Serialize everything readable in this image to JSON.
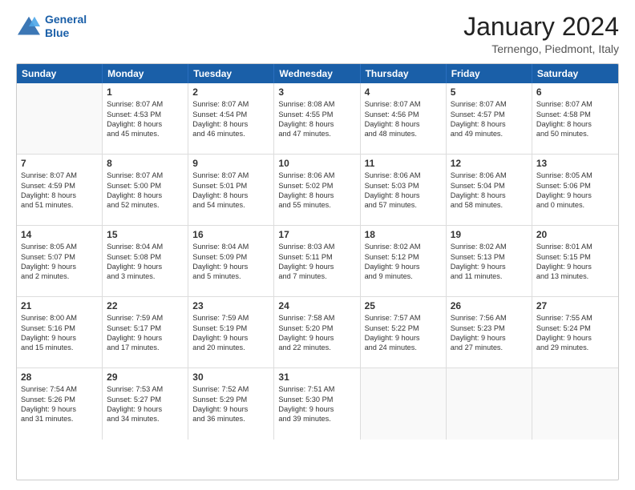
{
  "logo": {
    "line1": "General",
    "line2": "Blue"
  },
  "title": "January 2024",
  "location": "Ternengo, Piedmont, Italy",
  "header_days": [
    "Sunday",
    "Monday",
    "Tuesday",
    "Wednesday",
    "Thursday",
    "Friday",
    "Saturday"
  ],
  "weeks": [
    [
      {
        "day": "",
        "sunrise": "",
        "sunset": "",
        "daylight": "",
        "empty": true
      },
      {
        "day": "1",
        "sunrise": "Sunrise: 8:07 AM",
        "sunset": "Sunset: 4:53 PM",
        "daylight": "Daylight: 8 hours",
        "daylight2": "and 45 minutes."
      },
      {
        "day": "2",
        "sunrise": "Sunrise: 8:07 AM",
        "sunset": "Sunset: 4:54 PM",
        "daylight": "Daylight: 8 hours",
        "daylight2": "and 46 minutes."
      },
      {
        "day": "3",
        "sunrise": "Sunrise: 8:08 AM",
        "sunset": "Sunset: 4:55 PM",
        "daylight": "Daylight: 8 hours",
        "daylight2": "and 47 minutes."
      },
      {
        "day": "4",
        "sunrise": "Sunrise: 8:07 AM",
        "sunset": "Sunset: 4:56 PM",
        "daylight": "Daylight: 8 hours",
        "daylight2": "and 48 minutes."
      },
      {
        "day": "5",
        "sunrise": "Sunrise: 8:07 AM",
        "sunset": "Sunset: 4:57 PM",
        "daylight": "Daylight: 8 hours",
        "daylight2": "and 49 minutes."
      },
      {
        "day": "6",
        "sunrise": "Sunrise: 8:07 AM",
        "sunset": "Sunset: 4:58 PM",
        "daylight": "Daylight: 8 hours",
        "daylight2": "and 50 minutes."
      }
    ],
    [
      {
        "day": "7",
        "sunrise": "Sunrise: 8:07 AM",
        "sunset": "Sunset: 4:59 PM",
        "daylight": "Daylight: 8 hours",
        "daylight2": "and 51 minutes."
      },
      {
        "day": "8",
        "sunrise": "Sunrise: 8:07 AM",
        "sunset": "Sunset: 5:00 PM",
        "daylight": "Daylight: 8 hours",
        "daylight2": "and 52 minutes."
      },
      {
        "day": "9",
        "sunrise": "Sunrise: 8:07 AM",
        "sunset": "Sunset: 5:01 PM",
        "daylight": "Daylight: 8 hours",
        "daylight2": "and 54 minutes."
      },
      {
        "day": "10",
        "sunrise": "Sunrise: 8:06 AM",
        "sunset": "Sunset: 5:02 PM",
        "daylight": "Daylight: 8 hours",
        "daylight2": "and 55 minutes."
      },
      {
        "day": "11",
        "sunrise": "Sunrise: 8:06 AM",
        "sunset": "Sunset: 5:03 PM",
        "daylight": "Daylight: 8 hours",
        "daylight2": "and 57 minutes."
      },
      {
        "day": "12",
        "sunrise": "Sunrise: 8:06 AM",
        "sunset": "Sunset: 5:04 PM",
        "daylight": "Daylight: 8 hours",
        "daylight2": "and 58 minutes."
      },
      {
        "day": "13",
        "sunrise": "Sunrise: 8:05 AM",
        "sunset": "Sunset: 5:06 PM",
        "daylight": "Daylight: 9 hours",
        "daylight2": "and 0 minutes."
      }
    ],
    [
      {
        "day": "14",
        "sunrise": "Sunrise: 8:05 AM",
        "sunset": "Sunset: 5:07 PM",
        "daylight": "Daylight: 9 hours",
        "daylight2": "and 2 minutes."
      },
      {
        "day": "15",
        "sunrise": "Sunrise: 8:04 AM",
        "sunset": "Sunset: 5:08 PM",
        "daylight": "Daylight: 9 hours",
        "daylight2": "and 3 minutes."
      },
      {
        "day": "16",
        "sunrise": "Sunrise: 8:04 AM",
        "sunset": "Sunset: 5:09 PM",
        "daylight": "Daylight: 9 hours",
        "daylight2": "and 5 minutes."
      },
      {
        "day": "17",
        "sunrise": "Sunrise: 8:03 AM",
        "sunset": "Sunset: 5:11 PM",
        "daylight": "Daylight: 9 hours",
        "daylight2": "and 7 minutes."
      },
      {
        "day": "18",
        "sunrise": "Sunrise: 8:02 AM",
        "sunset": "Sunset: 5:12 PM",
        "daylight": "Daylight: 9 hours",
        "daylight2": "and 9 minutes."
      },
      {
        "day": "19",
        "sunrise": "Sunrise: 8:02 AM",
        "sunset": "Sunset: 5:13 PM",
        "daylight": "Daylight: 9 hours",
        "daylight2": "and 11 minutes."
      },
      {
        "day": "20",
        "sunrise": "Sunrise: 8:01 AM",
        "sunset": "Sunset: 5:15 PM",
        "daylight": "Daylight: 9 hours",
        "daylight2": "and 13 minutes."
      }
    ],
    [
      {
        "day": "21",
        "sunrise": "Sunrise: 8:00 AM",
        "sunset": "Sunset: 5:16 PM",
        "daylight": "Daylight: 9 hours",
        "daylight2": "and 15 minutes."
      },
      {
        "day": "22",
        "sunrise": "Sunrise: 7:59 AM",
        "sunset": "Sunset: 5:17 PM",
        "daylight": "Daylight: 9 hours",
        "daylight2": "and 17 minutes."
      },
      {
        "day": "23",
        "sunrise": "Sunrise: 7:59 AM",
        "sunset": "Sunset: 5:19 PM",
        "daylight": "Daylight: 9 hours",
        "daylight2": "and 20 minutes."
      },
      {
        "day": "24",
        "sunrise": "Sunrise: 7:58 AM",
        "sunset": "Sunset: 5:20 PM",
        "daylight": "Daylight: 9 hours",
        "daylight2": "and 22 minutes."
      },
      {
        "day": "25",
        "sunrise": "Sunrise: 7:57 AM",
        "sunset": "Sunset: 5:22 PM",
        "daylight": "Daylight: 9 hours",
        "daylight2": "and 24 minutes."
      },
      {
        "day": "26",
        "sunrise": "Sunrise: 7:56 AM",
        "sunset": "Sunset: 5:23 PM",
        "daylight": "Daylight: 9 hours",
        "daylight2": "and 27 minutes."
      },
      {
        "day": "27",
        "sunrise": "Sunrise: 7:55 AM",
        "sunset": "Sunset: 5:24 PM",
        "daylight": "Daylight: 9 hours",
        "daylight2": "and 29 minutes."
      }
    ],
    [
      {
        "day": "28",
        "sunrise": "Sunrise: 7:54 AM",
        "sunset": "Sunset: 5:26 PM",
        "daylight": "Daylight: 9 hours",
        "daylight2": "and 31 minutes."
      },
      {
        "day": "29",
        "sunrise": "Sunrise: 7:53 AM",
        "sunset": "Sunset: 5:27 PM",
        "daylight": "Daylight: 9 hours",
        "daylight2": "and 34 minutes."
      },
      {
        "day": "30",
        "sunrise": "Sunrise: 7:52 AM",
        "sunset": "Sunset: 5:29 PM",
        "daylight": "Daylight: 9 hours",
        "daylight2": "and 36 minutes."
      },
      {
        "day": "31",
        "sunrise": "Sunrise: 7:51 AM",
        "sunset": "Sunset: 5:30 PM",
        "daylight": "Daylight: 9 hours",
        "daylight2": "and 39 minutes."
      },
      {
        "day": "",
        "sunrise": "",
        "sunset": "",
        "daylight": "",
        "daylight2": "",
        "empty": true
      },
      {
        "day": "",
        "sunrise": "",
        "sunset": "",
        "daylight": "",
        "daylight2": "",
        "empty": true
      },
      {
        "day": "",
        "sunrise": "",
        "sunset": "",
        "daylight": "",
        "daylight2": "",
        "empty": true
      }
    ]
  ]
}
